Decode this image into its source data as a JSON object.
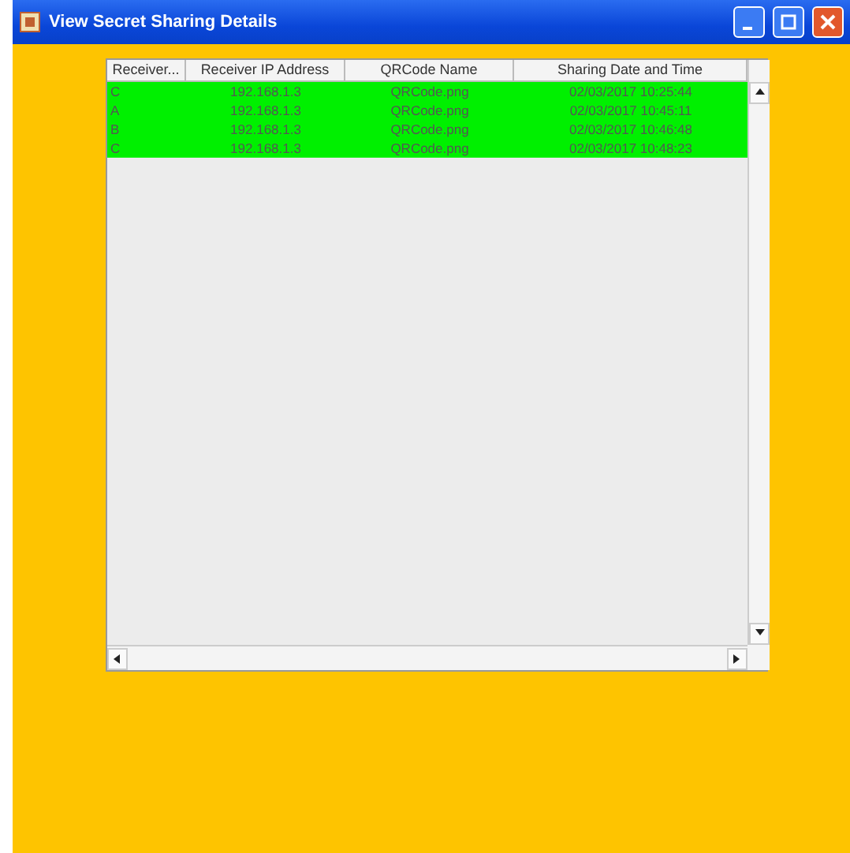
{
  "window": {
    "title": "View Secret Sharing Details"
  },
  "table": {
    "columns": [
      "Receiver...",
      "Receiver IP Address",
      "QRCode Name",
      "Sharing Date and Time"
    ],
    "rows": [
      {
        "cells": [
          "C",
          "192.168.1.3",
          "QRCode.png",
          "02/03/2017   10:25:44"
        ],
        "selected": true
      },
      {
        "cells": [
          "A",
          "192.168.1.3",
          "QRCode.png",
          "02/03/2017   10:45:11"
        ],
        "selected": true
      },
      {
        "cells": [
          "B",
          "192.168.1.3",
          "QRCode.png",
          "02/03/2017   10:46:48"
        ],
        "selected": true
      },
      {
        "cells": [
          "C",
          "192.168.1.3",
          "QRCode.png",
          "02/03/2017   10:48:23"
        ],
        "selected": true
      }
    ]
  }
}
